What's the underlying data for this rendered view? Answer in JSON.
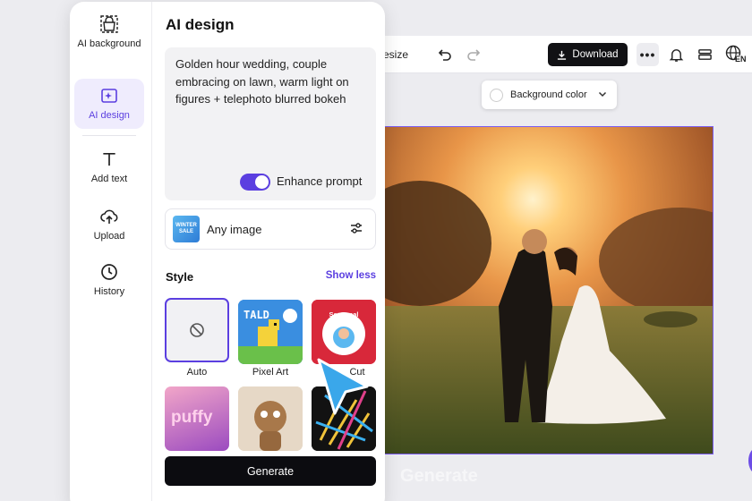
{
  "toolbar": {
    "resize_label": "esize",
    "download_label": "Download",
    "more_label": "•••",
    "language_label": "EN"
  },
  "canvas": {
    "background_color_label": "Background color",
    "ghost_generate_label": "Generate"
  },
  "rail": {
    "items": [
      {
        "label": "AI background",
        "icon": "bag-icon"
      },
      {
        "label": "AI design",
        "icon": "sparkle-image-icon"
      },
      {
        "label": "Add text",
        "icon": "text-icon"
      },
      {
        "label": "Upload",
        "icon": "cloud-upload-icon"
      },
      {
        "label": "History",
        "icon": "clock-icon"
      }
    ]
  },
  "panel": {
    "title": "AI design",
    "prompt": "Golden hour wedding, couple embracing on lawn, warm light on figures + telephoto blurred bokeh",
    "enhance_prompt_label": "Enhance prompt",
    "enhance_prompt_on": true,
    "image_select_label": "Any image",
    "image_thumb_text": "WINTER SALE",
    "style_label": "Style",
    "show_less_label": "Show less",
    "styles": [
      {
        "label": "Auto",
        "selected": true
      },
      {
        "label": "Pixel Art",
        "thumb_text": "TALD"
      },
      {
        "label": "Cut",
        "thumb_text": "Seasonal Discount"
      },
      {
        "label": "",
        "thumb_text": "puffy"
      },
      {
        "label": ""
      },
      {
        "label": ""
      }
    ],
    "generate_label": "Generate"
  },
  "colors": {
    "accent": "#5b3fe0",
    "dark_button": "#0c0c10",
    "selection_border": "#7b5cf0"
  }
}
